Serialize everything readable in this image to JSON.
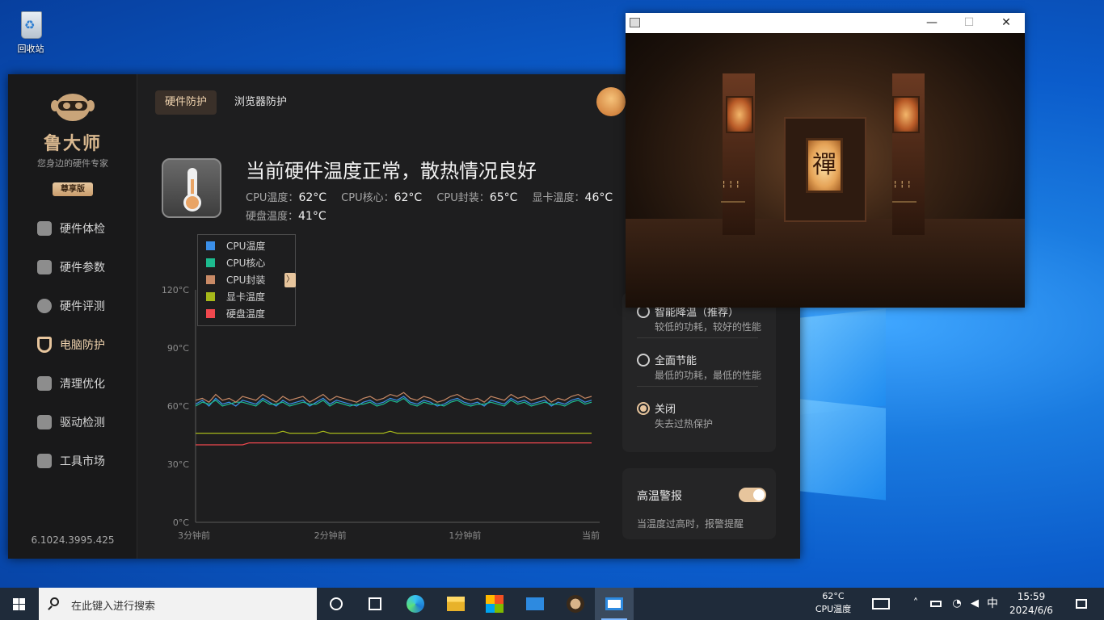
{
  "desktop": {
    "recycle_bin_label": "回收站"
  },
  "app": {
    "brand_name": "鲁大师",
    "brand_tagline": "您身边的硬件专家",
    "edition_badge": "尊享版",
    "version": "6.1024.3995.425",
    "nav": [
      {
        "label": "硬件体检",
        "icon": "plus-box-icon"
      },
      {
        "label": "硬件参数",
        "icon": "bar-chart-icon"
      },
      {
        "label": "硬件评测",
        "icon": "gauge-icon"
      },
      {
        "label": "电脑防护",
        "icon": "shield-icon",
        "active": true
      },
      {
        "label": "清理优化",
        "icon": "broom-icon"
      },
      {
        "label": "驱动检测",
        "icon": "drive-icon"
      },
      {
        "label": "工具市场",
        "icon": "toolbox-icon"
      }
    ],
    "tabs": [
      {
        "label": "硬件防护",
        "active": true
      },
      {
        "label": "浏览器防护",
        "active": false
      }
    ],
    "status": {
      "title": "当前硬件温度正常，散热情况良好",
      "readings": [
        {
          "label": "CPU温度：",
          "value": "62°C"
        },
        {
          "label": "CPU核心：",
          "value": "62°C"
        },
        {
          "label": "CPU封装：",
          "value": "65°C"
        },
        {
          "label": "显卡温度：",
          "value": "46°C"
        },
        {
          "label": "硬盘温度：",
          "value": "41°C"
        }
      ]
    },
    "power_modes": [
      {
        "title": "智能降温（推荐）",
        "desc": "较低的功耗，较好的性能",
        "selected": false
      },
      {
        "title": "全面节能",
        "desc": "最低的功耗，最低的性能",
        "selected": false
      },
      {
        "title": "关闭",
        "desc": "失去过热保护",
        "selected": true
      }
    ],
    "alert": {
      "title": "高温警报",
      "desc": "当温度过高时，报警提醒",
      "enabled": true
    },
    "legend_toggle": "〉",
    "accent_color": "#e7c59d"
  },
  "chart_data": {
    "type": "line",
    "x": [
      "3分钟前",
      "2分钟前",
      "1分钟前",
      "当前"
    ],
    "y_ticks": [
      "120°C",
      "90°C",
      "60°C",
      "30°C",
      "0°C"
    ],
    "ylim": [
      0,
      120
    ],
    "series": [
      {
        "name": "CPU温度",
        "color": "#3b8fe8",
        "values": [
          61,
          63,
          60,
          64,
          61,
          62,
          60,
          63,
          62,
          61,
          64,
          62,
          60,
          63,
          61,
          62,
          63,
          60,
          62,
          64,
          61,
          63,
          62,
          61,
          60,
          62,
          63,
          61,
          62,
          64,
          63,
          65,
          62,
          61,
          63,
          62,
          60,
          61,
          63,
          64,
          62,
          61,
          62,
          60,
          63,
          62,
          61,
          64,
          62,
          63,
          61,
          62,
          63,
          60,
          62,
          61,
          63,
          64,
          62,
          63
        ]
      },
      {
        "name": "CPU核心",
        "color": "#1dbb8f",
        "values": [
          60,
          62,
          61,
          63,
          60,
          61,
          62,
          62,
          61,
          60,
          63,
          61,
          61,
          62,
          60,
          61,
          62,
          61,
          61,
          63,
          60,
          62,
          61,
          60,
          61,
          61,
          62,
          60,
          61,
          63,
          62,
          64,
          61,
          60,
          62,
          61,
          61,
          60,
          62,
          63,
          61,
          60,
          61,
          61,
          62,
          61,
          60,
          63,
          61,
          62,
          60,
          61,
          62,
          61,
          61,
          60,
          62,
          63,
          61,
          62
        ]
      },
      {
        "name": "CPU封装",
        "color": "#c98a66",
        "values": [
          63,
          64,
          62,
          66,
          63,
          64,
          62,
          65,
          64,
          63,
          66,
          64,
          62,
          65,
          63,
          64,
          65,
          62,
          64,
          66,
          63,
          65,
          64,
          63,
          62,
          64,
          65,
          63,
          64,
          66,
          65,
          67,
          64,
          63,
          65,
          64,
          62,
          63,
          65,
          66,
          64,
          63,
          64,
          62,
          65,
          64,
          63,
          66,
          64,
          65,
          63,
          64,
          65,
          62,
          64,
          63,
          65,
          66,
          64,
          65
        ]
      },
      {
        "name": "显卡温度",
        "color": "#a6b81a",
        "values": [
          46,
          46,
          46,
          46,
          46,
          46,
          46,
          46,
          46,
          46,
          46,
          46,
          46,
          47,
          46,
          46,
          46,
          46,
          46,
          47,
          46,
          46,
          46,
          46,
          46,
          46,
          46,
          46,
          46,
          47,
          46,
          46,
          46,
          46,
          46,
          46,
          46,
          46,
          46,
          46,
          46,
          46,
          46,
          46,
          46,
          46,
          46,
          46,
          46,
          46,
          46,
          46,
          46,
          46,
          46,
          46,
          46,
          46,
          46,
          46
        ]
      },
      {
        "name": "硬盘温度",
        "color": "#f0484e",
        "values": [
          40,
          40,
          40,
          40,
          40,
          40,
          40,
          40,
          41,
          41,
          41,
          41,
          41,
          41,
          41,
          41,
          41,
          41,
          41,
          41,
          41,
          41,
          41,
          41,
          41,
          41,
          41,
          41,
          41,
          41,
          41,
          41,
          41,
          41,
          41,
          41,
          41,
          41,
          41,
          41,
          41,
          41,
          41,
          41,
          41,
          41,
          41,
          41,
          41,
          41,
          41,
          41,
          41,
          41,
          41,
          41,
          41,
          41,
          41,
          41
        ]
      }
    ],
    "grid": false,
    "legend_position": "top-left"
  },
  "game_window": {
    "plaque_char": "禪",
    "controls": {
      "minimize": "—",
      "maximize": "☐",
      "close": "✕"
    }
  },
  "taskbar": {
    "search_placeholder": "在此键入进行搜索",
    "pinned": [
      "task-view-icon",
      "widgets-icon",
      "edge-icon",
      "file-explorer-icon",
      "store-icon",
      "mail-icon",
      "ludashi-icon",
      "app-window-icon"
    ],
    "tray_temp_value": "62°C",
    "tray_temp_label": "CPU温度",
    "ime": "中",
    "time": "15:59",
    "date": "2024/6/6"
  }
}
